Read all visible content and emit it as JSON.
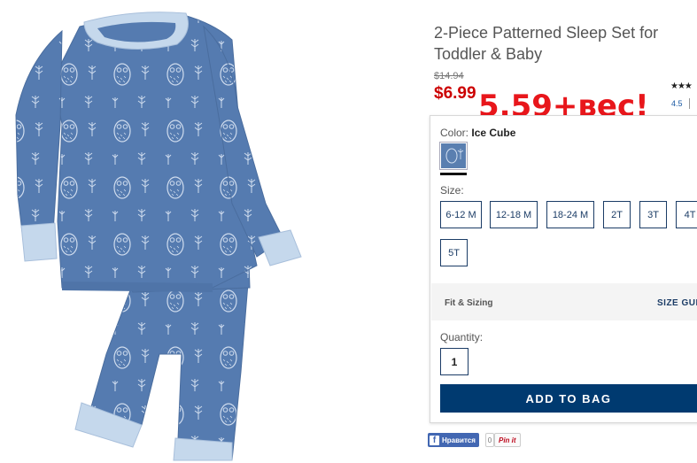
{
  "product": {
    "title": "2-Piece Patterned Sleep Set for Toddler & Baby",
    "old_price": "$14.94",
    "sale_price": "$6.99",
    "handwritten_note": "5,59+вес!",
    "rating_stars": "★★★",
    "rating_value": "4.5",
    "image_alt": "Blue owl-print toddler pajama set"
  },
  "color": {
    "label": "Color:",
    "value": "Ice Cube",
    "swatch_color": "#5a7fb0"
  },
  "size": {
    "label": "Size:",
    "options": [
      "6-12 M",
      "12-18 M",
      "18-24 M",
      "2T",
      "3T",
      "4T",
      "5T"
    ]
  },
  "fit": {
    "label": "Fit & Sizing",
    "guide_label": "SIZE GUIDE"
  },
  "quantity": {
    "label": "Quantity:",
    "value": "1"
  },
  "cart": {
    "add_label": "ADD TO BAG",
    "button_color": "#003a70"
  },
  "social": {
    "fb_label": "Нравится",
    "pin_count": "0",
    "pin_label": "Pin it"
  },
  "colors": {
    "sale": "#cc0000",
    "note": "#e8161b",
    "pajama_blue": "#557bb0",
    "cuff_blue": "#c5d8ec"
  }
}
